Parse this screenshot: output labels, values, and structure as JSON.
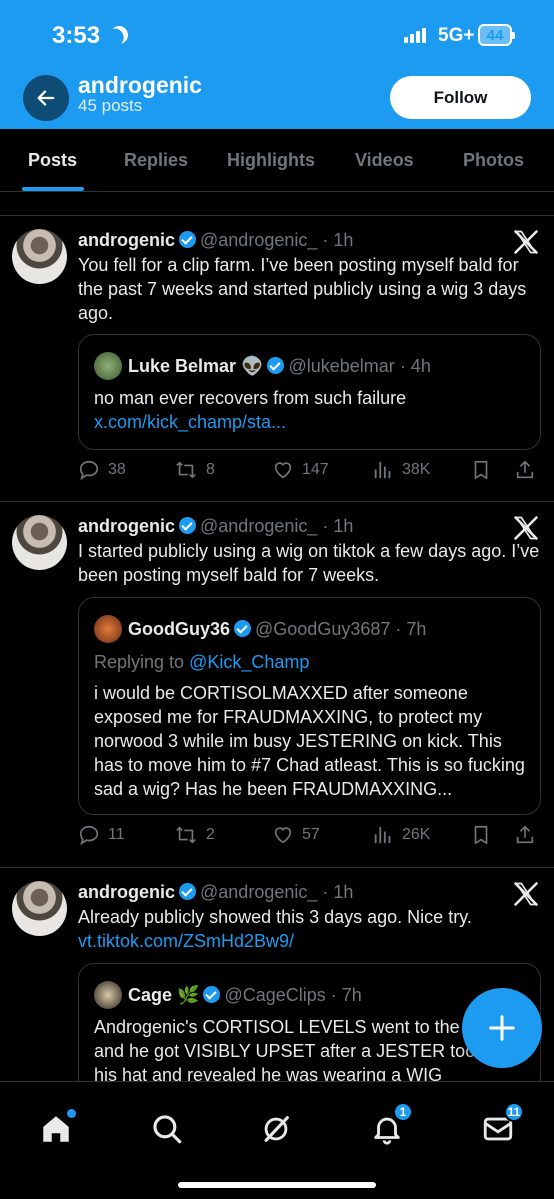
{
  "status_bar": {
    "time": "3:53",
    "network": "5G+",
    "battery": "44"
  },
  "profile": {
    "name": "androgenic",
    "posts_count": "45 posts",
    "follow_label": "Follow"
  },
  "tabs": [
    "Posts",
    "Replies",
    "Highlights",
    "Videos",
    "Photos"
  ],
  "posts": [
    {
      "author": "androgenic",
      "handle": "@androgenic_",
      "time": "· 1h",
      "text": "You fell for a clip farm. I’ve been posting myself bald for the past 7 weeks and started publicly using a wig 3 days ago.",
      "quote": {
        "author": "Luke Belmar",
        "emoji": "👽",
        "handle": "@lukebelmar",
        "time": "· 4h",
        "text": "no man ever recovers from such failure ",
        "link": "x.com/kick_champ/sta..."
      },
      "stats": {
        "replies": "38",
        "reposts": "8",
        "likes": "147",
        "views": "38K"
      }
    },
    {
      "author": "androgenic",
      "handle": "@androgenic_",
      "time": "· 1h",
      "text": "I started publicly using a wig on tiktok a few days ago. I’ve been posting myself bald for 7 weeks.",
      "quote": {
        "author": "GoodGuy36",
        "handle": "@GoodGuy3687",
        "time": "· 7h",
        "replying_prefix": "Replying to ",
        "replying_to": "@Kick_Champ",
        "text": "i would be CORTISOLMAXXED after someone exposed me for FRAUDMAXXING, to protect my norwood 3 while im busy JESTERING on kick. This has to move him to #7 Chad atleast. This is so fucking sad a wig? Has he been FRAUDMAXXING..."
      },
      "stats": {
        "replies": "11",
        "reposts": "2",
        "likes": "57",
        "views": "26K"
      }
    },
    {
      "author": "androgenic",
      "handle": "@androgenic_",
      "time": "· 1h",
      "text": "Already publicly showed this 3 days ago. Nice try.",
      "link": "vt.tiktok.com/ZSmHd2Bw9/",
      "quote": {
        "author": "Cage",
        "emoji": "🌿",
        "handle": "@CageClips",
        "time": "· 7h",
        "text": "Androgenic's CORTISOL LEVELS went to the MOON and he got VISIBLY UPSET after a JESTER took off his hat and revealed he was wearing a WIG"
      }
    }
  ],
  "bottom_nav": {
    "notifications_badge": "1",
    "messages_badge": "11"
  },
  "colors": {
    "accent": "#1d9bf0",
    "background": "#000000",
    "muted": "#71767b"
  }
}
